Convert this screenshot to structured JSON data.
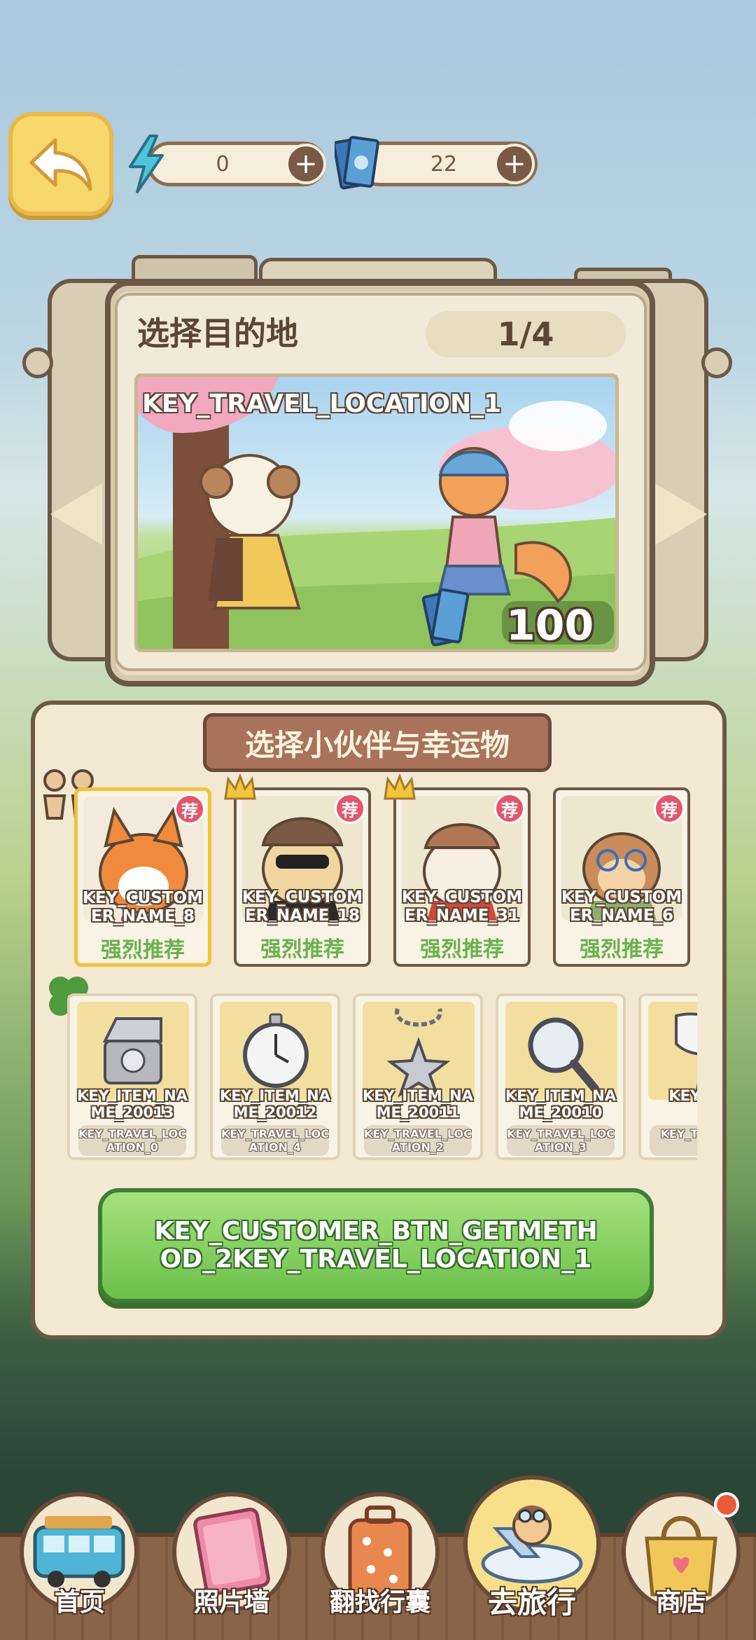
{
  "resources": {
    "energy": "0",
    "tickets": "22"
  },
  "destination": {
    "title": "选择目的地",
    "page": "1/4",
    "location_key": "KEY_TRAVEL_LOCATION_1",
    "cost": "100"
  },
  "selection": {
    "header": "选择小伙伴与幸运物",
    "partners": [
      {
        "name": "KEY_CUSTOMER_NAME_8",
        "tag": "荐",
        "label": "强烈推荐",
        "selected": true
      },
      {
        "name": "KEY_CUSTOMER_NAME_18",
        "tag": "荐",
        "label": "强烈推荐",
        "selected": false
      },
      {
        "name": "KEY_CUSTOMER_NAME_31",
        "tag": "荐",
        "label": "强烈推荐",
        "selected": false
      },
      {
        "name": "KEY_CUSTOMER_NAME_6",
        "tag": "荐",
        "label": "强烈推荐",
        "selected": false
      }
    ],
    "items": [
      {
        "name": "KEY_ITEM_NAME_20013",
        "location": "KEY_TRAVEL_LOCATION_0",
        "icon": "jewelry-box-icon"
      },
      {
        "name": "KEY_ITEM_NAME_20012",
        "location": "KEY_TRAVEL_LOCATION_4",
        "icon": "pocket-watch-icon"
      },
      {
        "name": "KEY_ITEM_NAME_20011",
        "location": "KEY_TRAVEL_LOCATION_2",
        "icon": "star-charm-icon"
      },
      {
        "name": "KEY_ITEM_NAME_20010",
        "location": "KEY_TRAVEL_LOCATION_3",
        "icon": "magnifier-icon"
      },
      {
        "name": "KEY_IT...",
        "location": "KEY_T...LOC...",
        "icon": "fan-icon"
      }
    ],
    "go_button": "KEY_CUSTOMER_BTN_GETMETHOD_2KEY_TRAVEL_LOCATION_1"
  },
  "nav": [
    {
      "label": "首页",
      "icon": "bus-icon"
    },
    {
      "label": "照片墙",
      "icon": "photo-album-icon"
    },
    {
      "label": "翻找行囊",
      "icon": "suitcase-icon"
    },
    {
      "label": "去旅行",
      "icon": "airplane-icon"
    },
    {
      "label": "商店",
      "icon": "shopping-bag-icon"
    }
  ],
  "colors": {
    "accent_green": "#6cc04b",
    "recommend_text": "#6ab14d",
    "tag_red": "#e4566e",
    "header_brown": "#a8735a",
    "notification_dot": "#ec5a39"
  }
}
